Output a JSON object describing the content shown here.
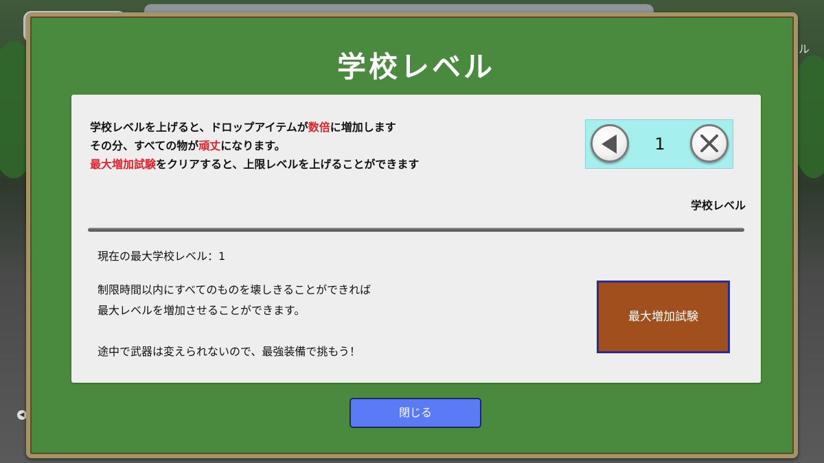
{
  "title": "学校レベル",
  "description": {
    "line1_a": "学校レベルを上げると、ドロップアイテムが",
    "line1_hl": "数倍",
    "line1_b": "に増加します",
    "line2_a": "その分、すべての物が",
    "line2_hl": "頑丈",
    "line2_b": "になります。",
    "line3_hl": "最大増加試験",
    "line3_b": "をクリアすると、上限レベルを上げることができます"
  },
  "level_selector": {
    "value": "1",
    "label": "学校レベル",
    "left_icon": "triangle-left-icon",
    "right_icon": "close-x-icon"
  },
  "max_level": "現在の最大学校レベル：1",
  "info": {
    "line1": "制限時間以内にすべてのものを壊しきることができれば",
    "line2": "最大レベルを増加させることができます。",
    "line3": "途中で武器は変えられないので、最強装備で挑もう！"
  },
  "trial_button": "最大増加試験",
  "close_button": "閉じる",
  "colors": {
    "board": "#4a8a3e",
    "highlight": "#e8202a",
    "level_box": "#a5f0ee",
    "trial_button": "#a14f1c",
    "close_button": "#5b7bf6"
  }
}
